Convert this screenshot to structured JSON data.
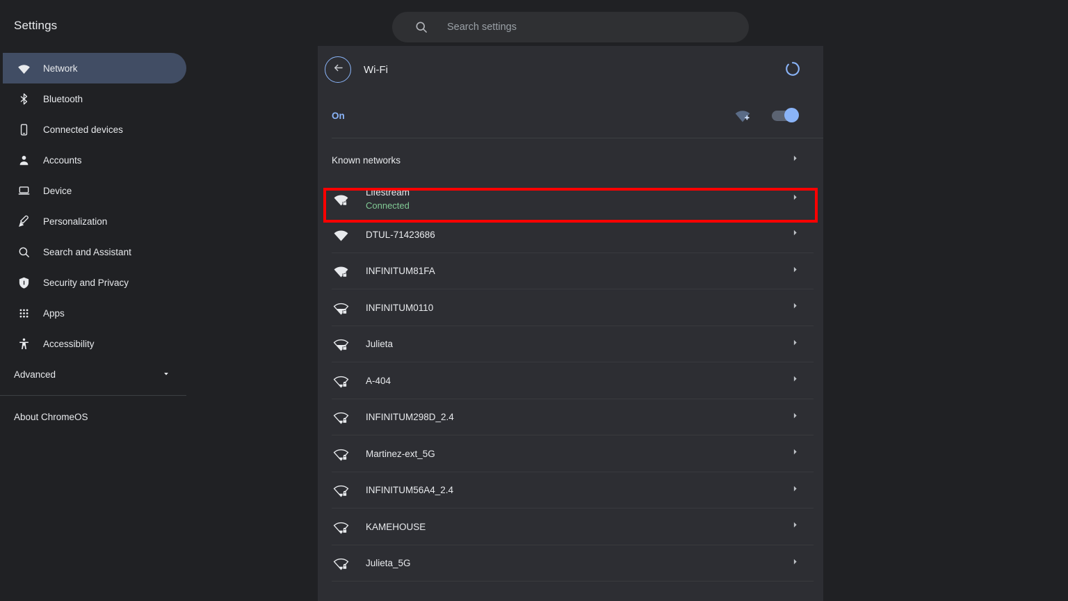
{
  "app": {
    "title": "Settings",
    "background": "#202124",
    "panel_background": "#2d2e33",
    "accent": "#8ab4f8",
    "connected_color": "#81c995",
    "highlight_color": "#fe0000"
  },
  "search": {
    "placeholder": "Search settings",
    "value": "",
    "icon": "search-icon"
  },
  "sidebar": {
    "items": [
      {
        "label": "Network",
        "icon": "wifi-icon",
        "selected": true
      },
      {
        "label": "Bluetooth",
        "icon": "bluetooth-icon",
        "selected": false
      },
      {
        "label": "Connected devices",
        "icon": "phone-icon",
        "selected": false
      },
      {
        "label": "Accounts",
        "icon": "person-icon",
        "selected": false
      },
      {
        "label": "Device",
        "icon": "laptop-icon",
        "selected": false
      },
      {
        "label": "Personalization",
        "icon": "brush-icon",
        "selected": false
      },
      {
        "label": "Search and Assistant",
        "icon": "search-icon",
        "selected": false
      },
      {
        "label": "Security and Privacy",
        "icon": "shield-icon",
        "selected": false
      },
      {
        "label": "Apps",
        "icon": "grid-icon",
        "selected": false
      },
      {
        "label": "Accessibility",
        "icon": "accessibility-icon",
        "selected": false
      }
    ],
    "advanced": {
      "label": "Advanced",
      "icon": "chevron-down-icon"
    },
    "about": {
      "label": "About ChromeOS"
    }
  },
  "wifi_page": {
    "title": "Wi-Fi",
    "back_icon": "arrow-left-icon",
    "loading_icon": "spinner-icon",
    "state_label": "On",
    "add_network_icon": "add-wifi-icon",
    "toggle_on": true,
    "known_networks_label": "Known networks",
    "chevron_icon": "chevron-right-icon",
    "networks": [
      {
        "name": "Lifestream",
        "status": "Connected",
        "secured": true,
        "bars": 4,
        "highlighted": true
      },
      {
        "name": "DTUL-71423686",
        "status": "",
        "secured": false,
        "bars": 4,
        "highlighted": false
      },
      {
        "name": "INFINITUM81FA",
        "status": "",
        "secured": true,
        "bars": 4,
        "highlighted": false
      },
      {
        "name": "INFINITUM0110",
        "status": "",
        "secured": true,
        "bars": 2,
        "highlighted": false
      },
      {
        "name": "Julieta",
        "status": "",
        "secured": true,
        "bars": 2,
        "highlighted": false
      },
      {
        "name": "A-404",
        "status": "",
        "secured": true,
        "bars": 1,
        "highlighted": false
      },
      {
        "name": "INFINITUM298D_2.4",
        "status": "",
        "secured": true,
        "bars": 1,
        "highlighted": false
      },
      {
        "name": "Martinez-ext_5G",
        "status": "",
        "secured": true,
        "bars": 1,
        "highlighted": false
      },
      {
        "name": "INFINITUM56A4_2.4",
        "status": "",
        "secured": true,
        "bars": 1,
        "highlighted": false
      },
      {
        "name": "KAMEHOUSE",
        "status": "",
        "secured": true,
        "bars": 1,
        "highlighted": false
      },
      {
        "name": "Julieta_5G",
        "status": "",
        "secured": true,
        "bars": 1,
        "highlighted": false
      }
    ]
  }
}
